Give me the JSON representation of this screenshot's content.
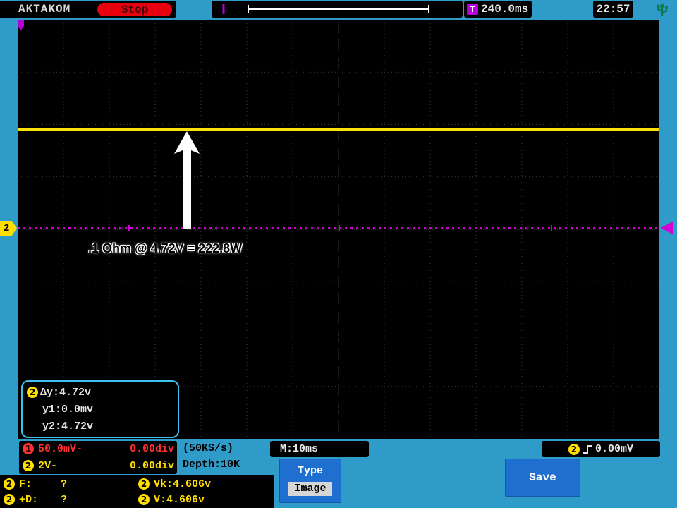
{
  "colors": {
    "frame_blue": "#2f9bc9",
    "channel1_red": "#ff3232",
    "channel2_yellow": "#ffdf00",
    "math_magenta": "#cc00cc",
    "trace_yellow": "#ffe100",
    "stop_red": "#e8000e",
    "trigger_purple": "#b400d8",
    "button_blue": "#1f6fd0"
  },
  "top_bar": {
    "brand": "AKTAKOM",
    "stop_label": "Stop",
    "trigger_symbol": "T",
    "trigger_time": "240.0ms",
    "clock": "22:57"
  },
  "scope": {
    "annotation": ".1 Ohm @ 4.72V = 222.8W",
    "ch2_marker": "2",
    "cursor_panel": {
      "badge": "2",
      "line1": "Δy:4.72v",
      "line2": "y1:0.0mv",
      "line3": "y2:4.72v"
    }
  },
  "status_bar": {
    "ch1": {
      "badge": "1",
      "scale": "50.0mV-",
      "offset": "0.00div"
    },
    "ch2": {
      "badge": "2",
      "scale": "2V-",
      "offset": "0.00div"
    },
    "sample_rate": "(50KS/s)",
    "depth": "Depth:10K",
    "timebase": "M:10ms",
    "trigger": {
      "badge": "2",
      "level": "0.00mV"
    },
    "measurements": {
      "badge": "2",
      "f_label": "F:",
      "f_value": "?",
      "d_label": "+D:",
      "d_value": "?",
      "vk_value": "Vk:4.606v",
      "v_value": "V:4.606v"
    },
    "type_button": {
      "label": "Type",
      "value": "Image"
    },
    "save_button": "Save"
  }
}
